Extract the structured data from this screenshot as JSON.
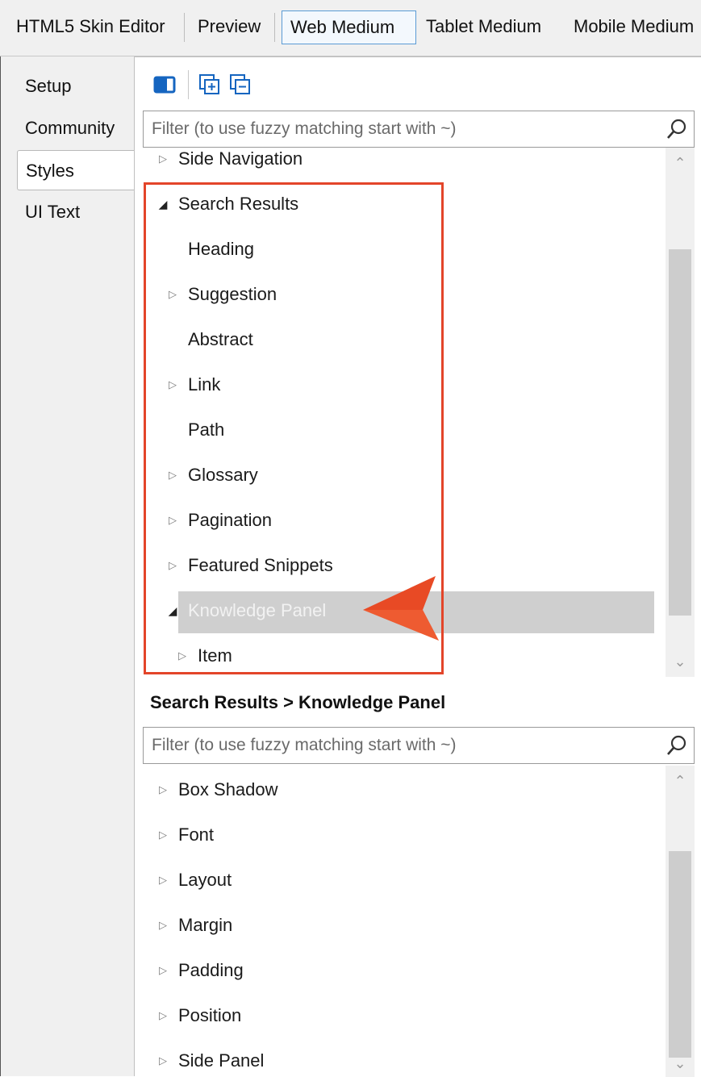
{
  "toolbar": {
    "tabs": [
      {
        "label": "HTML5 Skin Editor"
      },
      {
        "label": "Preview"
      },
      {
        "label": "Web Medium",
        "active": true
      },
      {
        "label": "Tablet Medium"
      },
      {
        "label": "Mobile Medium"
      }
    ]
  },
  "side_tabs": [
    {
      "label": "Setup"
    },
    {
      "label": "Community"
    },
    {
      "label": "Styles",
      "selected": true
    },
    {
      "label": "UI Text"
    }
  ],
  "styles_panel": {
    "icons": [
      "toggle-panel-icon",
      "expand-all-icon",
      "collapse-all-icon"
    ],
    "filter_placeholder": "Filter (to use fuzzy matching start with ~)",
    "tree": [
      {
        "label": "Side Navigation",
        "expander": "collapsed"
      },
      {
        "label": "Search Results",
        "expander": "expanded"
      },
      {
        "label": "Heading",
        "expander": "none"
      },
      {
        "label": "Suggestion",
        "expander": "collapsed"
      },
      {
        "label": "Abstract",
        "expander": "none"
      },
      {
        "label": "Link",
        "expander": "collapsed"
      },
      {
        "label": "Path",
        "expander": "none"
      },
      {
        "label": "Glossary",
        "expander": "collapsed"
      },
      {
        "label": "Pagination",
        "expander": "collapsed"
      },
      {
        "label": "Featured Snippets",
        "expander": "collapsed"
      },
      {
        "label": "Knowledge Panel",
        "expander": "expanded",
        "selected": true
      },
      {
        "label": "Item",
        "expander": "collapsed"
      }
    ]
  },
  "properties_panel": {
    "selection_path": "Search Results > Knowledge Panel",
    "filter_placeholder": "Filter (to use fuzzy matching start with ~)",
    "items": [
      {
        "label": "Box Shadow"
      },
      {
        "label": "Font"
      },
      {
        "label": "Layout"
      },
      {
        "label": "Margin"
      },
      {
        "label": "Padding"
      },
      {
        "label": "Position"
      },
      {
        "label": "Side Panel"
      }
    ]
  },
  "colors": {
    "highlight_border": "#e3452a",
    "callout_arrow": "#e84a25",
    "active_tab_border": "#5a9bd5",
    "icon_blue": "#1565c0",
    "selected_row": "#cfcfcf"
  }
}
